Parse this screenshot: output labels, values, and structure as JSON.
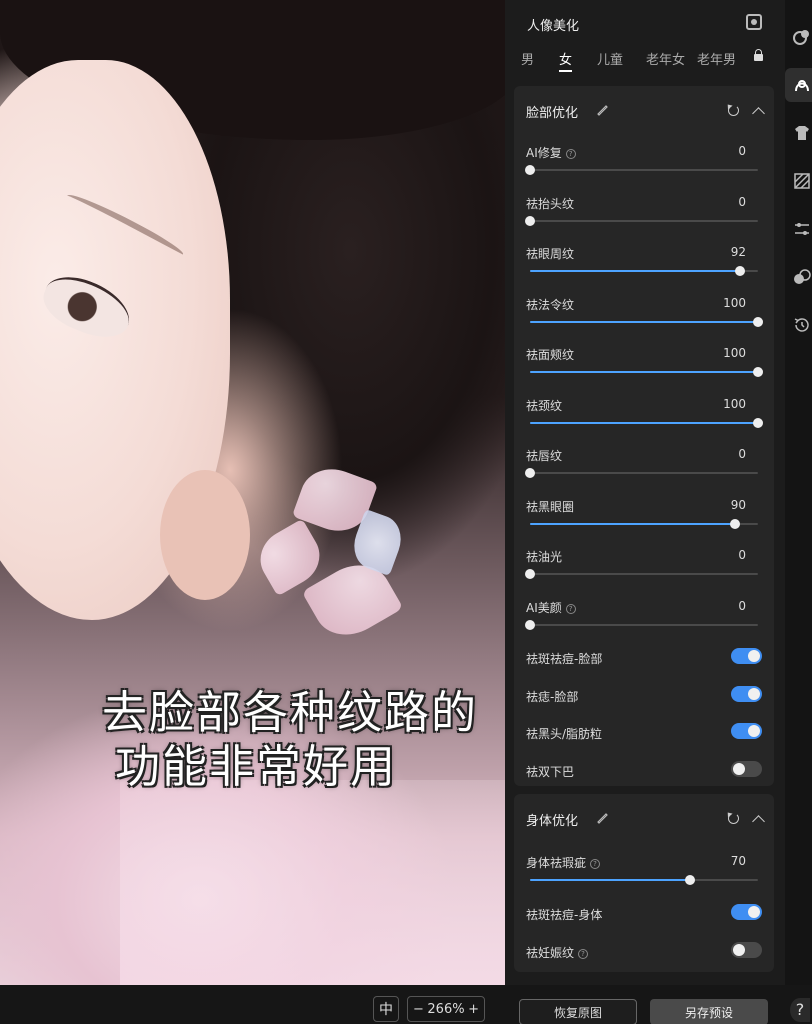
{
  "panel": {
    "title": "人像美化",
    "tabs": [
      "男",
      "女",
      "儿童",
      "老年女",
      "老年男"
    ],
    "active_tab": "女"
  },
  "face_section": {
    "title": "脸部优化",
    "sliders": [
      {
        "label": "AI修复",
        "value": 0,
        "help": true
      },
      {
        "label": "祛抬头纹",
        "value": 0,
        "help": false
      },
      {
        "label": "祛眼周纹",
        "value": 92,
        "help": false
      },
      {
        "label": "祛法令纹",
        "value": 100,
        "help": false
      },
      {
        "label": "祛面颊纹",
        "value": 100,
        "help": false
      },
      {
        "label": "祛颈纹",
        "value": 100,
        "help": false
      },
      {
        "label": "祛唇纹",
        "value": 0,
        "help": false
      },
      {
        "label": "祛黑眼圈",
        "value": 90,
        "help": false
      },
      {
        "label": "祛油光",
        "value": 0,
        "help": false
      },
      {
        "label": "AI美颜",
        "value": 0,
        "help": true
      }
    ],
    "toggles": [
      {
        "label": "祛斑祛痘-脸部",
        "on": true
      },
      {
        "label": "祛痣-脸部",
        "on": true
      },
      {
        "label": "祛黑头/脂肪粒",
        "on": true
      },
      {
        "label": "祛双下巴",
        "on": false
      }
    ]
  },
  "body_section": {
    "title": "身体优化",
    "slider": {
      "label": "身体祛瑕疵",
      "value": 70,
      "help": true
    },
    "toggles": [
      {
        "label": "祛斑祛痘-身体",
        "on": true
      },
      {
        "label": "祛妊娠纹",
        "on": false,
        "help": true
      }
    ]
  },
  "footer": {
    "reset_label": "恢复原图",
    "save_preset_label": "另存预设",
    "fit_glyph": "中",
    "zoom_minus": "−",
    "zoom_level": "266%",
    "zoom_plus": "+"
  },
  "caption": {
    "line1": "去脸部各种纹路的",
    "line2": "功能非常好用"
  },
  "help_glyph": "?",
  "colors": {
    "accent": "#4da3ff",
    "toggle_on": "#3f8ef2",
    "panel_bg": "#1c1c1c",
    "card_bg": "#262626"
  }
}
